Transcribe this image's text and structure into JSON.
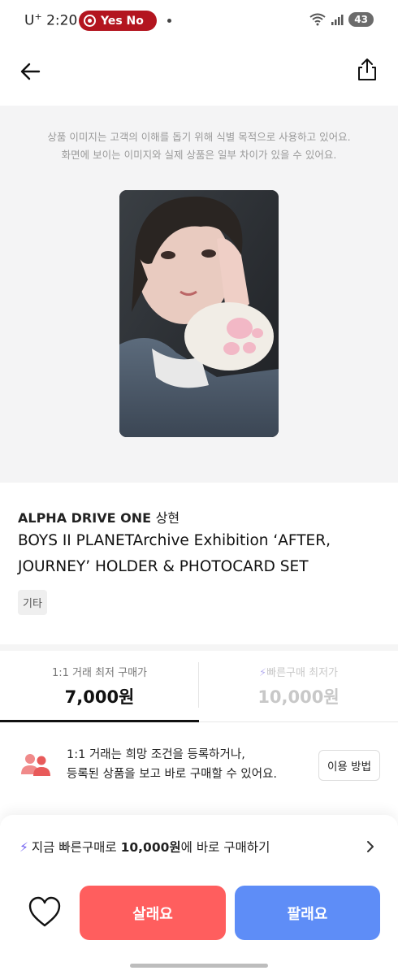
{
  "status_bar": {
    "carrier": "U",
    "carrier_sup": "+",
    "time": "2:20",
    "pill_text": "Yes No",
    "battery": "43"
  },
  "image_notice": {
    "line1": "상품 이미지는 고객의 이해를 돕기 위해 식별 목적으로 사용하고 있어요.",
    "line2": "화면에 보이는 이미지와 실제 상품은 일부 차이가 있을 수 있어요."
  },
  "product": {
    "artist": "ALPHA DRIVE ONE",
    "member": "상현",
    "title": "BOYS II PLANETArchive Exhibition ‘AFTER, JOURNEY’ HOLDER &  PHOTOCARD SET",
    "tag": "기타"
  },
  "price_tabs": [
    {
      "label": "1:1 거래 최저 구매가",
      "value": "7,000원",
      "selected": true
    },
    {
      "label": "빠른구매 최저가",
      "value": "10,000원",
      "selected": false
    }
  ],
  "info": {
    "line1": "1:1 거래는 희망 조건을 등록하거나,",
    "line2": "등록된 상품을 보고 바로 구매할 수 있어요.",
    "how_button": "이용 방법"
  },
  "quick_buy": {
    "prefix": "지금 빠른구매로 ",
    "amount": "10,000원",
    "suffix": "에 바로 구매하기"
  },
  "actions": {
    "buy_label": "살래요",
    "sell_label": "팔래요"
  },
  "colors": {
    "buy": "#ff5e5e",
    "sell": "#5e8df7",
    "accent_bolt": "#6f5ff0",
    "record_pill": "#b3151f"
  },
  "icons": [
    "back-arrow-icon",
    "share-icon",
    "people-icon",
    "bolt-icon",
    "chevron-right-icon",
    "heart-icon",
    "wifi-icon",
    "signal-icon",
    "record-icon"
  ]
}
